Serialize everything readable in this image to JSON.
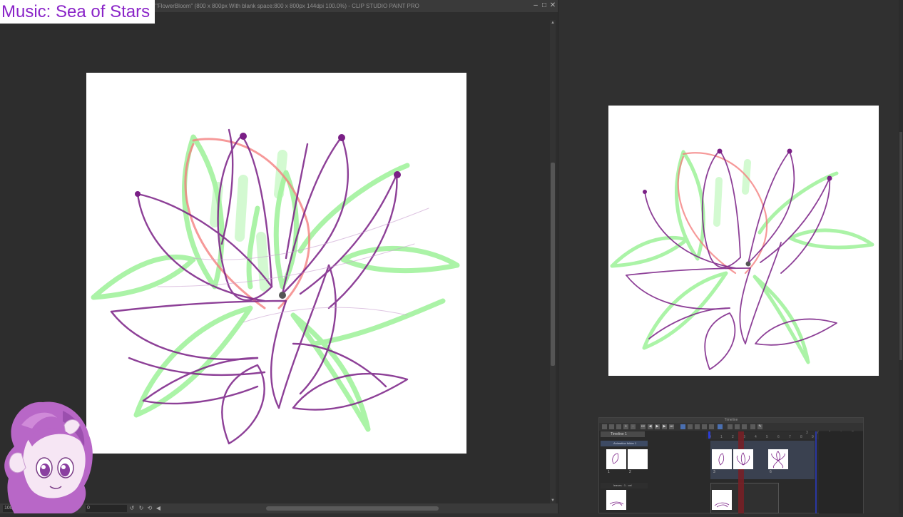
{
  "window": {
    "title": "\"FlowerBloom\" (800 x 800px With blank space:800 x 800px 144dpi 100.0%)  - CLIP STUDIO PAINT PRO",
    "minimize_icon": "minimize-icon",
    "maximize_icon": "maximize-icon",
    "close_icon": "close-icon"
  },
  "overlay": {
    "music_label": "Music: Sea of Stars",
    "text_color": "#8a24c8"
  },
  "statusbar": {
    "zoom_value": "100.0",
    "rotation_value": "0"
  },
  "timeline": {
    "panel_title": "Timeline",
    "timeline_name": "Timeline 1",
    "ruler_top": [
      "3",
      "/",
      "1",
      "/",
      "3"
    ],
    "ruler_frames": [
      "0",
      "1",
      "2",
      "3",
      "4",
      "5",
      "6",
      "7",
      "8",
      "9",
      "10",
      "11",
      "12",
      "13"
    ],
    "layers": [
      {
        "name": "Animation folder 1"
      },
      {
        "name": "leaves : 1 . cel"
      }
    ],
    "cel_numbers": [
      "1",
      "2",
      "3",
      "6"
    ],
    "playhead_color": "#7a1e24",
    "marker_color": "#2b3dd6"
  },
  "colors": {
    "accent_purple": "#7a1f86",
    "sketch_green": "#7de87a",
    "sketch_red": "#f07878",
    "canvas_bg": "#2d2d2d"
  }
}
